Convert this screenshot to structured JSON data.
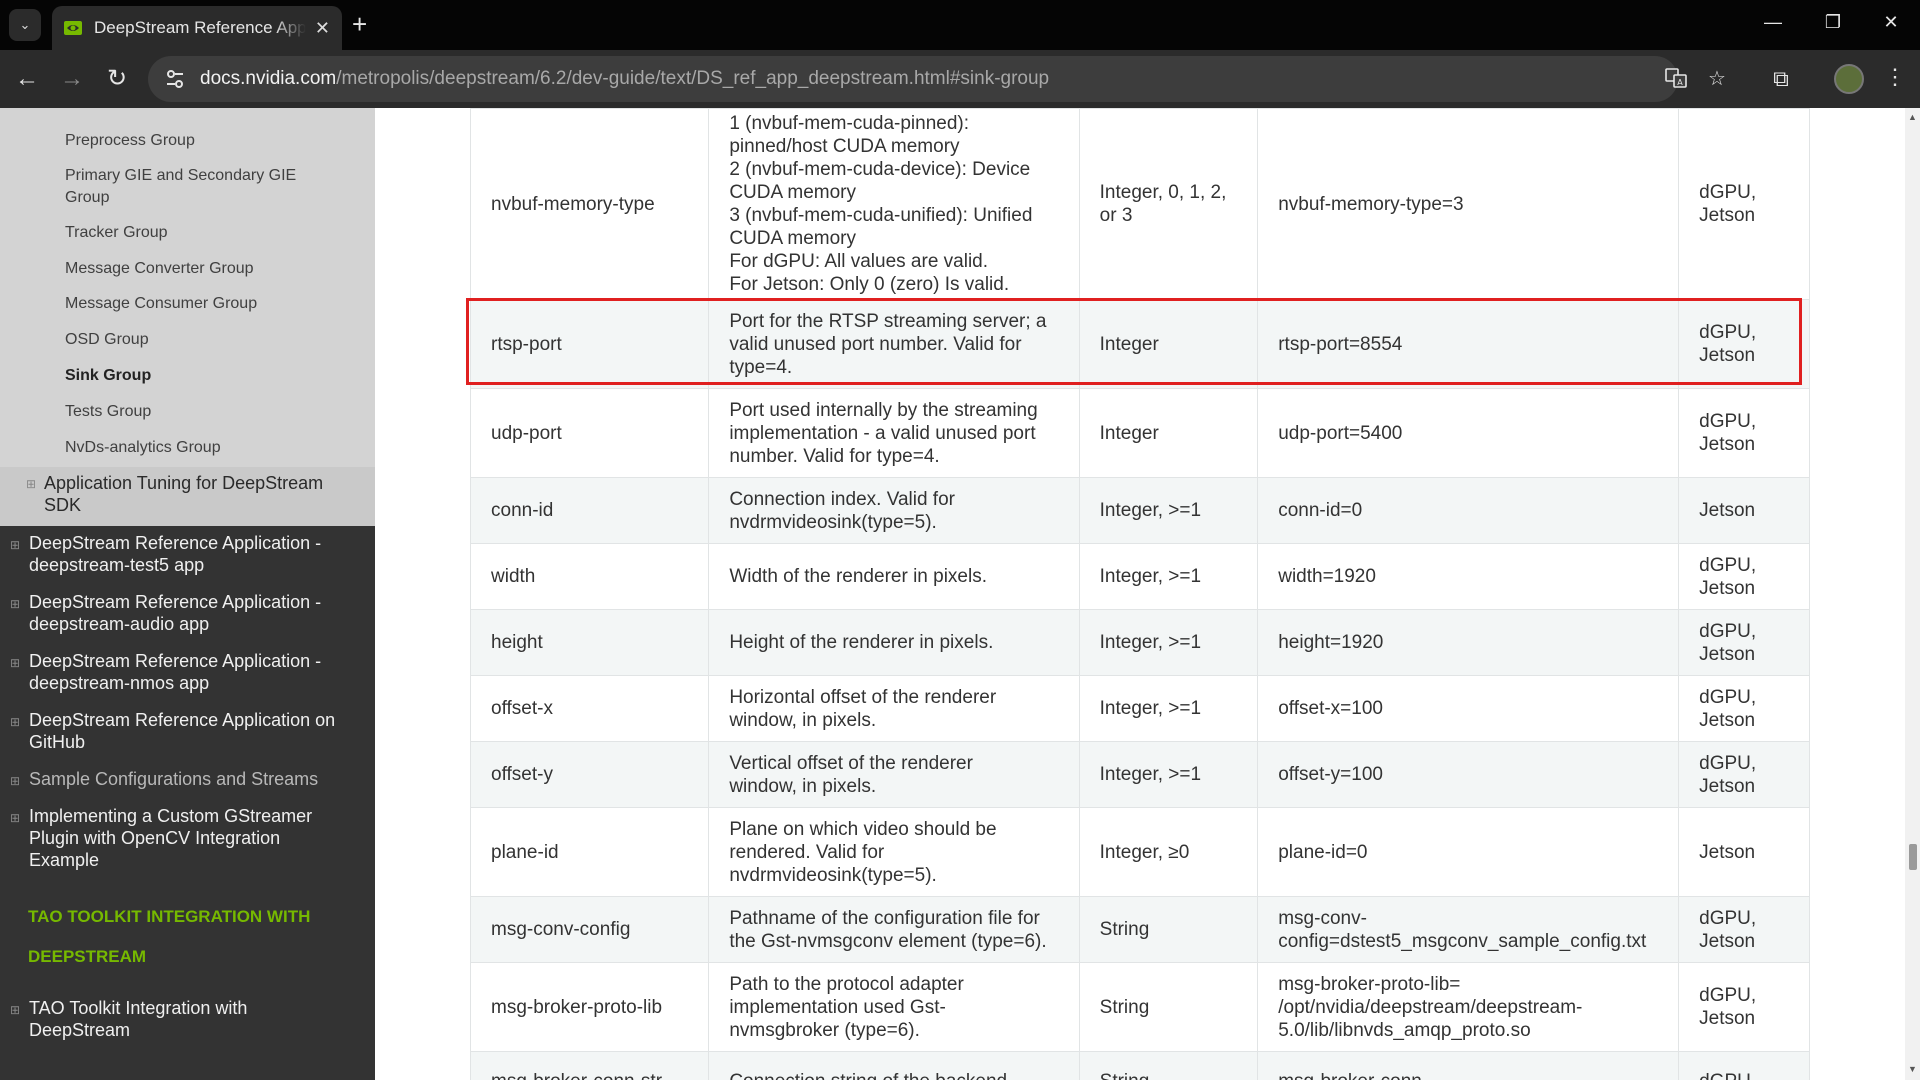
{
  "browser": {
    "tab_title": "DeepStream Reference Application - deepstream-app",
    "url_host": "docs.nvidia.com",
    "url_path": "/metropolis/deepstream/6.2/dev-guide/text/DS_ref_app_deepstream.html#sink-group",
    "glyphs": {
      "dropdown": "⌄",
      "close": "✕",
      "new_tab": "+",
      "back": "←",
      "forward": "→",
      "reload": "↻",
      "minimize": "—",
      "restore": "❐",
      "window_close": "✕",
      "star": "☆",
      "menu": "⋮",
      "extensions": "⧉"
    }
  },
  "sidebar": {
    "sub_items": [
      {
        "label": "Preprocess Group"
      },
      {
        "label": "Primary GIE and Secondary GIE Group"
      },
      {
        "label": "Tracker Group"
      },
      {
        "label": "Message Converter Group"
      },
      {
        "label": "Message Consumer Group"
      },
      {
        "label": "OSD Group"
      },
      {
        "label": "Sink Group"
      },
      {
        "label": "Tests Group"
      },
      {
        "label": "NvDs-analytics Group"
      }
    ],
    "tuning_item": "Application Tuning for DeepStream SDK",
    "dark_items": [
      {
        "label": "DeepStream Reference Application - deepstream-test5 app"
      },
      {
        "label": "DeepStream Reference Application - deepstream-audio app"
      },
      {
        "label": "DeepStream Reference Application - deepstream-nmos app"
      },
      {
        "label": "DeepStream Reference Application on GitHub"
      },
      {
        "label": "Sample Configurations and Streams"
      },
      {
        "label": "Implementing a Custom GStreamer Plugin with OpenCV Integration Example"
      }
    ],
    "section_heading_1": "TAO TOOLKIT INTEGRATION WITH",
    "section_heading_2": "DEEPSTREAM",
    "tao_item": "TAO Toolkit Integration with DeepStream",
    "expand_glyph": "⊞"
  },
  "table": {
    "rows": [
      {
        "key": "nvbuf-memory-type",
        "desc": [
          "1 (nvbuf-mem-cuda-pinned):",
          "pinned/host CUDA memory",
          "2 (nvbuf-mem-cuda-device): Device",
          "CUDA memory",
          "3 (nvbuf-mem-cuda-unified): Unified",
          "CUDA memory",
          "For dGPU: All values are valid.",
          "For Jetson: Only 0 (zero) Is valid."
        ],
        "type": [
          "Integer, 0, 1, 2,",
          "or 3"
        ],
        "example": [
          "nvbuf-memory-type=3"
        ],
        "platform": [
          "dGPU,",
          "Jetson"
        ]
      },
      {
        "key": "rtsp-port",
        "desc": [
          "Port for the RTSP streaming server; a",
          "valid unused port number. Valid for",
          "type=4."
        ],
        "type": [
          "Integer"
        ],
        "example": [
          "rtsp-port=8554"
        ],
        "platform": [
          "dGPU,",
          "Jetson"
        ]
      },
      {
        "key": "udp-port",
        "desc": [
          "Port used internally by the streaming",
          "implementation - a valid unused port",
          "number. Valid for type=4."
        ],
        "type": [
          "Integer"
        ],
        "example": [
          "udp-port=5400"
        ],
        "platform": [
          "dGPU,",
          "Jetson"
        ]
      },
      {
        "key": "conn-id",
        "desc": [
          "Connection index. Valid for",
          "nvdrmvideosink(type=5)."
        ],
        "type": [
          "Integer, >=1"
        ],
        "example": [
          "conn-id=0"
        ],
        "platform": [
          "Jetson"
        ]
      },
      {
        "key": "width",
        "desc": [
          "Width of the renderer in pixels."
        ],
        "type": [
          "Integer, >=1"
        ],
        "example": [
          "width=1920"
        ],
        "platform": [
          "dGPU,",
          "Jetson"
        ]
      },
      {
        "key": "height",
        "desc": [
          "Height of the renderer in pixels."
        ],
        "type": [
          "Integer, >=1"
        ],
        "example": [
          "height=1920"
        ],
        "platform": [
          "dGPU,",
          "Jetson"
        ]
      },
      {
        "key": "offset-x",
        "desc": [
          "Horizontal offset of the renderer",
          "window, in pixels."
        ],
        "type": [
          "Integer, >=1"
        ],
        "example": [
          "offset-x=100"
        ],
        "platform": [
          "dGPU,",
          "Jetson"
        ]
      },
      {
        "key": "offset-y",
        "desc": [
          "Vertical offset of the renderer",
          "window, in pixels."
        ],
        "type": [
          "Integer, >=1"
        ],
        "example": [
          "offset-y=100"
        ],
        "platform": [
          "dGPU,",
          "Jetson"
        ]
      },
      {
        "key": "plane-id",
        "desc": [
          "Plane on which video should be",
          "rendered. Valid for",
          "nvdrmvideosink(type=5)."
        ],
        "type": [
          "Integer, ≥0"
        ],
        "example": [
          "plane-id=0"
        ],
        "platform": [
          "Jetson"
        ]
      },
      {
        "key": "msg-conv-config",
        "desc": [
          "Pathname of the configuration file for",
          "the Gst-nvmsgconv element (type=6)."
        ],
        "type": [
          "String"
        ],
        "example": [
          "msg-conv-",
          "config=dstest5_msgconv_sample_config.txt"
        ],
        "platform": [
          "dGPU,",
          "Jetson"
        ]
      },
      {
        "key": "msg-broker-proto-lib",
        "desc": [
          "Path to the protocol adapter",
          "implementation used Gst-",
          "nvmsgbroker (type=6)."
        ],
        "type": [
          "String"
        ],
        "example": [
          "msg-broker-proto-lib=",
          "/opt/nvidia/deepstream/deepstream-",
          "5.0/lib/libnvds_amqp_proto.so"
        ],
        "platform": [
          "dGPU,",
          "Jetson"
        ]
      },
      {
        "key": "msg-broker-conn-str",
        "desc": [
          "Connection string of the backend"
        ],
        "type": [
          "String"
        ],
        "example": [
          "msg-broker-conn-"
        ],
        "platform": [
          "dGPU,"
        ]
      }
    ]
  },
  "colors": {
    "highlight": "#e02020",
    "nvidia_green": "#76b900"
  }
}
